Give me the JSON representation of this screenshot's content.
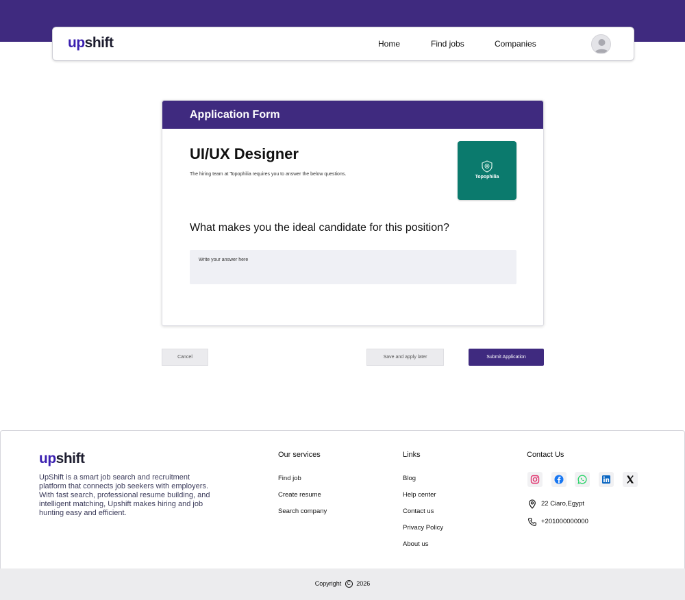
{
  "brand": {
    "logo_up": "up",
    "logo_shift": "shift"
  },
  "nav": {
    "links": [
      {
        "label": "Home"
      },
      {
        "label": "Find jobs"
      },
      {
        "label": "Companies"
      }
    ],
    "avatar_icon": "user-avatar-icon"
  },
  "form": {
    "header": "Application Form",
    "job_title": "UI/UX Designer",
    "subtitle": "The hiring team at Topophilia requires you to answer the below questions.",
    "company_name": "Topophilia",
    "company_color": "#0b7a6d",
    "question": "What makes you the ideal candidate for this position?",
    "answer_placeholder": "Write your answer here",
    "answer_value": ""
  },
  "actions": {
    "cancel": "Cancel",
    "save": "Save and apply later",
    "submit": "Submit Application"
  },
  "footer": {
    "logo_up": "up",
    "logo_shift": "shift",
    "description": "UpShift is a smart job search and recruitment platform that connects job seekers with employers. With fast search, professional resume building, and intelligent matching, Upshift makes hiring and job hunting easy and efficient.",
    "services": {
      "title": "Our services",
      "items": [
        "Find job",
        "Create resume",
        "Search company"
      ]
    },
    "links": {
      "title": "Links",
      "items": [
        "Blog",
        "Help center",
        "Contact us",
        "Privacy Policy",
        "About us"
      ]
    },
    "contact": {
      "title": "Contact Us",
      "social_icons": [
        "instagram-icon",
        "facebook-icon",
        "whatsapp-icon",
        "linkedin-icon",
        "x-icon"
      ],
      "address": "22 Ciaro,Egypt",
      "phone": "+201000000000"
    },
    "copyright_prefix": "Copyright",
    "copyright_symbol": "C",
    "copyright_year": "2026"
  },
  "colors": {
    "primary": "#3f2a7f",
    "logo_accent": "#3a1fb0",
    "input_bg": "#eff0f5"
  }
}
